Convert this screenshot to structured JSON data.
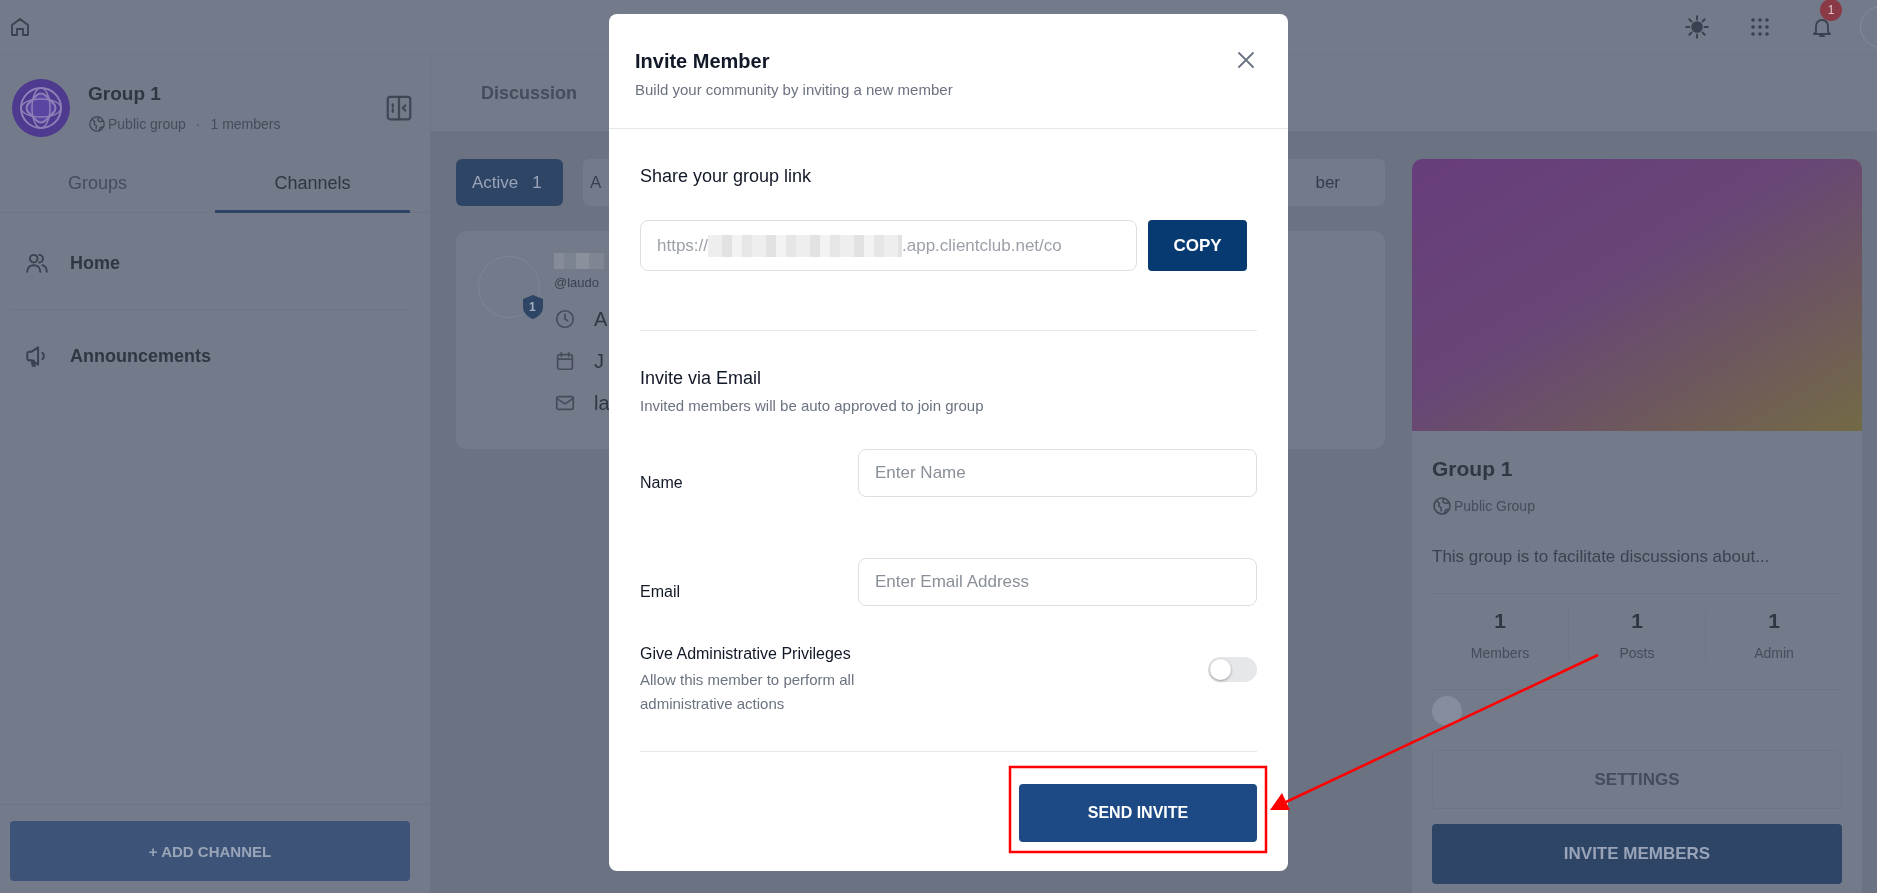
{
  "top_bar": {
    "notification_count": "1"
  },
  "sidebar": {
    "group": {
      "name": "Group 1",
      "visibility": "Public group",
      "separator": "·",
      "members": "1 members"
    },
    "tabs": [
      {
        "label": "Groups",
        "selected": false
      },
      {
        "label": "Channels",
        "selected": true
      }
    ],
    "items": [
      {
        "label": "Home"
      },
      {
        "label": "Announcements"
      }
    ],
    "add_button": "+ ADD CHANNEL"
  },
  "main": {
    "tab": "Discussion",
    "filters": [
      {
        "label": "Active",
        "count": "1",
        "selected": true
      },
      {
        "label": "A",
        "selected": false
      }
    ],
    "search": {
      "placeholder": "ber"
    },
    "member": {
      "badge": "1",
      "handle": "@laudo",
      "details": [
        {
          "text": "A"
        },
        {
          "text": "J"
        },
        {
          "text": "la"
        }
      ]
    }
  },
  "about": {
    "name": "Group 1",
    "visibility": "Public Group",
    "description": "This group is to facilitate discussions about...",
    "stats": [
      {
        "value": "1",
        "label": "Members"
      },
      {
        "value": "1",
        "label": "Posts"
      },
      {
        "value": "1",
        "label": "Admin"
      }
    ],
    "settings": "SETTINGS",
    "invite": "INVITE MEMBERS"
  },
  "dialog": {
    "title": "Invite Member",
    "subtitle": "Build your community by inviting a new member",
    "link": {
      "heading": "Share your group link",
      "prefix": "https://",
      "suffix": ".app.clientclub.net/co",
      "copy": "COPY"
    },
    "email": {
      "heading": "Invite via Email",
      "subtitle": "Invited members will be auto approved to join group",
      "fields": [
        {
          "label": "Name",
          "placeholder": "Enter Name"
        },
        {
          "label": "Email",
          "placeholder": "Enter Email Address"
        }
      ]
    },
    "admin": {
      "title": "Give Administrative Privileges",
      "description": "Allow this member to perform all administrative actions",
      "on": false
    },
    "submit": "SEND INVITE"
  }
}
